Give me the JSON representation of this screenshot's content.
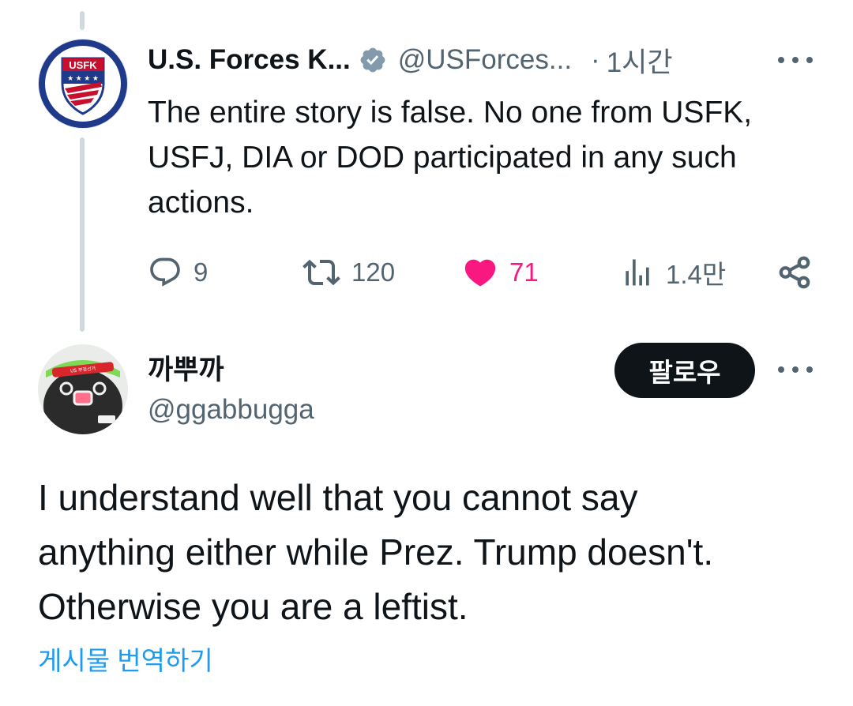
{
  "tweet": {
    "author_name": "U.S. Forces K...",
    "author_handle": "@USForces...",
    "separator": "·",
    "time": "1시간",
    "avatar_logo_text": "USFK",
    "text": "The entire story is false. No one from USFK, USFJ, DIA or DOD participated in any such actions.",
    "stats": {
      "replies": "9",
      "retweets": "120",
      "likes": "71",
      "views": "1.4만"
    },
    "icons": {
      "verified": "verified-badge-icon",
      "more": "more-options-icon",
      "reply": "reply-icon",
      "retweet": "retweet-icon",
      "like": "heart-icon",
      "views": "views-icon",
      "share": "share-icon"
    }
  },
  "reply": {
    "author_name": "까뿌까",
    "author_handle": "@ggabbugga",
    "follow_label": "팔로우",
    "text_lines": [
      "I understand well that you cannot say",
      "anything either while Prez. Trump doesn't.",
      "Otherwise you are a leftist."
    ],
    "translate_label": "게시물 번역하기"
  },
  "colors": {
    "text_primary": "#0f1419",
    "text_secondary": "#536471",
    "like_active": "#f91880",
    "link": "#1d9bf0",
    "thread_line": "#cfd9de",
    "follow_bg": "#0f1419",
    "usfk_blue": "#1f3a8a",
    "usfk_red": "#c8102e"
  }
}
